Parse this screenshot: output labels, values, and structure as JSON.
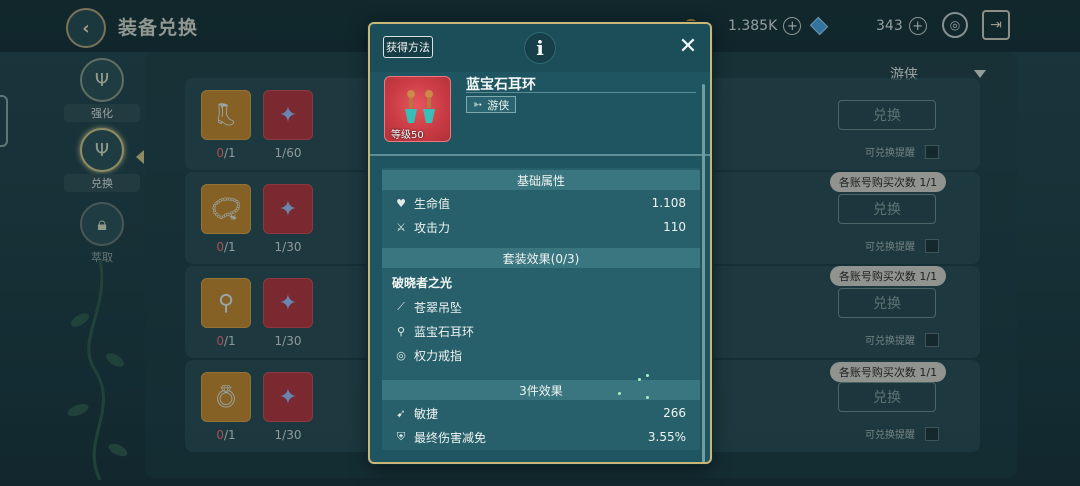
{
  "header": {
    "title": "装备兑换"
  },
  "currencies": {
    "coins": "1.385K",
    "gems": "343"
  },
  "nav": [
    {
      "label": "强化",
      "icon": "trident-icon"
    },
    {
      "label": "兑换",
      "icon": "trident-icon"
    },
    {
      "label": "萃取",
      "icon": "lock-icon"
    }
  ],
  "filter": {
    "selected": "游侠"
  },
  "rows": [
    {
      "count1_have": "0",
      "count1_need": "/1",
      "count2_have": "1",
      "count2_need": "/60",
      "button": "兑换",
      "remind": "可兑换提醒",
      "limit": ""
    },
    {
      "count1_have": "0",
      "count1_need": "/1",
      "count2_have": "1",
      "count2_need": "/30",
      "button": "兑换",
      "remind": "可兑换提醒",
      "limit": "各账号购买次数 1/1"
    },
    {
      "count1_have": "0",
      "count1_need": "/1",
      "count2_have": "1",
      "count2_need": "/30",
      "button": "兑换",
      "remind": "可兑换提醒",
      "limit": "各账号购买次数 1/1"
    },
    {
      "count1_have": "0",
      "count1_need": "/1",
      "count2_have": "1",
      "count2_need": "/30",
      "button": "兑换",
      "remind": "可兑换提醒",
      "limit": "各账号购买次数 1/1"
    }
  ],
  "popup": {
    "source_button": "获得方法",
    "item": {
      "name": "蓝宝石耳环",
      "level": "等级50",
      "class": "游侠"
    },
    "basic_title": "基础属性",
    "basic_stats": [
      {
        "icon": "heart-icon",
        "label": "生命值",
        "value": "1.108"
      },
      {
        "icon": "crossed-swords-icon",
        "label": "攻击力",
        "value": "110"
      }
    ],
    "set_title": "套装效果(0/3)",
    "set_name": "破晓者之光",
    "set_pieces": [
      {
        "icon": "pendant-icon",
        "label": "苍翠吊坠"
      },
      {
        "icon": "earring-icon",
        "label": "蓝宝石耳环"
      },
      {
        "icon": "ring-icon",
        "label": "权力戒指"
      }
    ],
    "bonus_title": "3件效果",
    "bonus_stats": [
      {
        "icon": "runner-icon",
        "label": "敏捷",
        "value": "266"
      },
      {
        "icon": "damage-reduce-icon",
        "label": "最终伤害减免",
        "value": "3.55%"
      }
    ]
  },
  "colors": {
    "popup_border": "#c9b77a",
    "item_bg": "#c83a43",
    "panel": "#1f5561"
  }
}
